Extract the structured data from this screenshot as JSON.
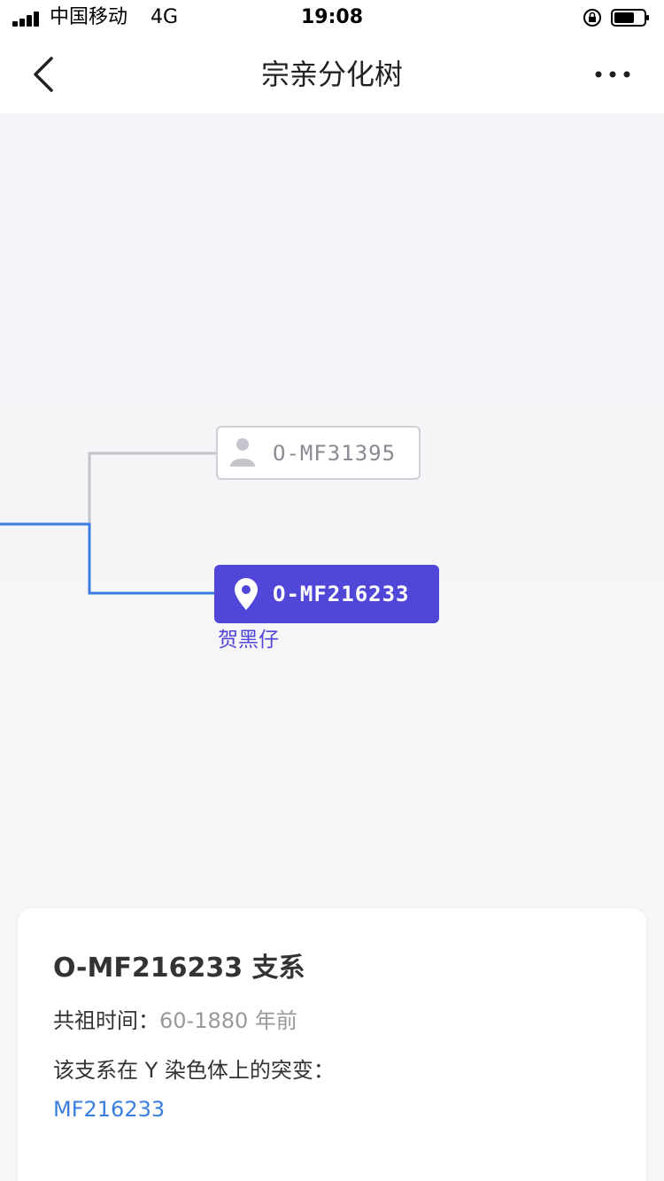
{
  "status_bar": {
    "carrier": "中国移动",
    "network": "4G",
    "time": "19:08"
  },
  "nav": {
    "title": "宗亲分化树",
    "back_icon": "chevron-left-icon",
    "more_icon": "more-dots-icon"
  },
  "tree": {
    "nodes": [
      {
        "id": "O-MF31395",
        "state": "inactive",
        "icon": "person-icon"
      },
      {
        "id": "O-MF216233",
        "state": "active",
        "icon": "location-pin-icon",
        "person": "贺黑仔"
      }
    ],
    "colors": {
      "active_line": "#3a7fe0",
      "inactive_line": "#c4c4cc",
      "active_node": "#5046d8"
    }
  },
  "card": {
    "title": "O-MF216233 支系",
    "common_ancestor_label": "共祖时间：",
    "common_ancestor_value": "60-1880 年前",
    "mutation_label": "该支系在 Y 染色体上的突变：",
    "mutation_value": "MF216233"
  }
}
